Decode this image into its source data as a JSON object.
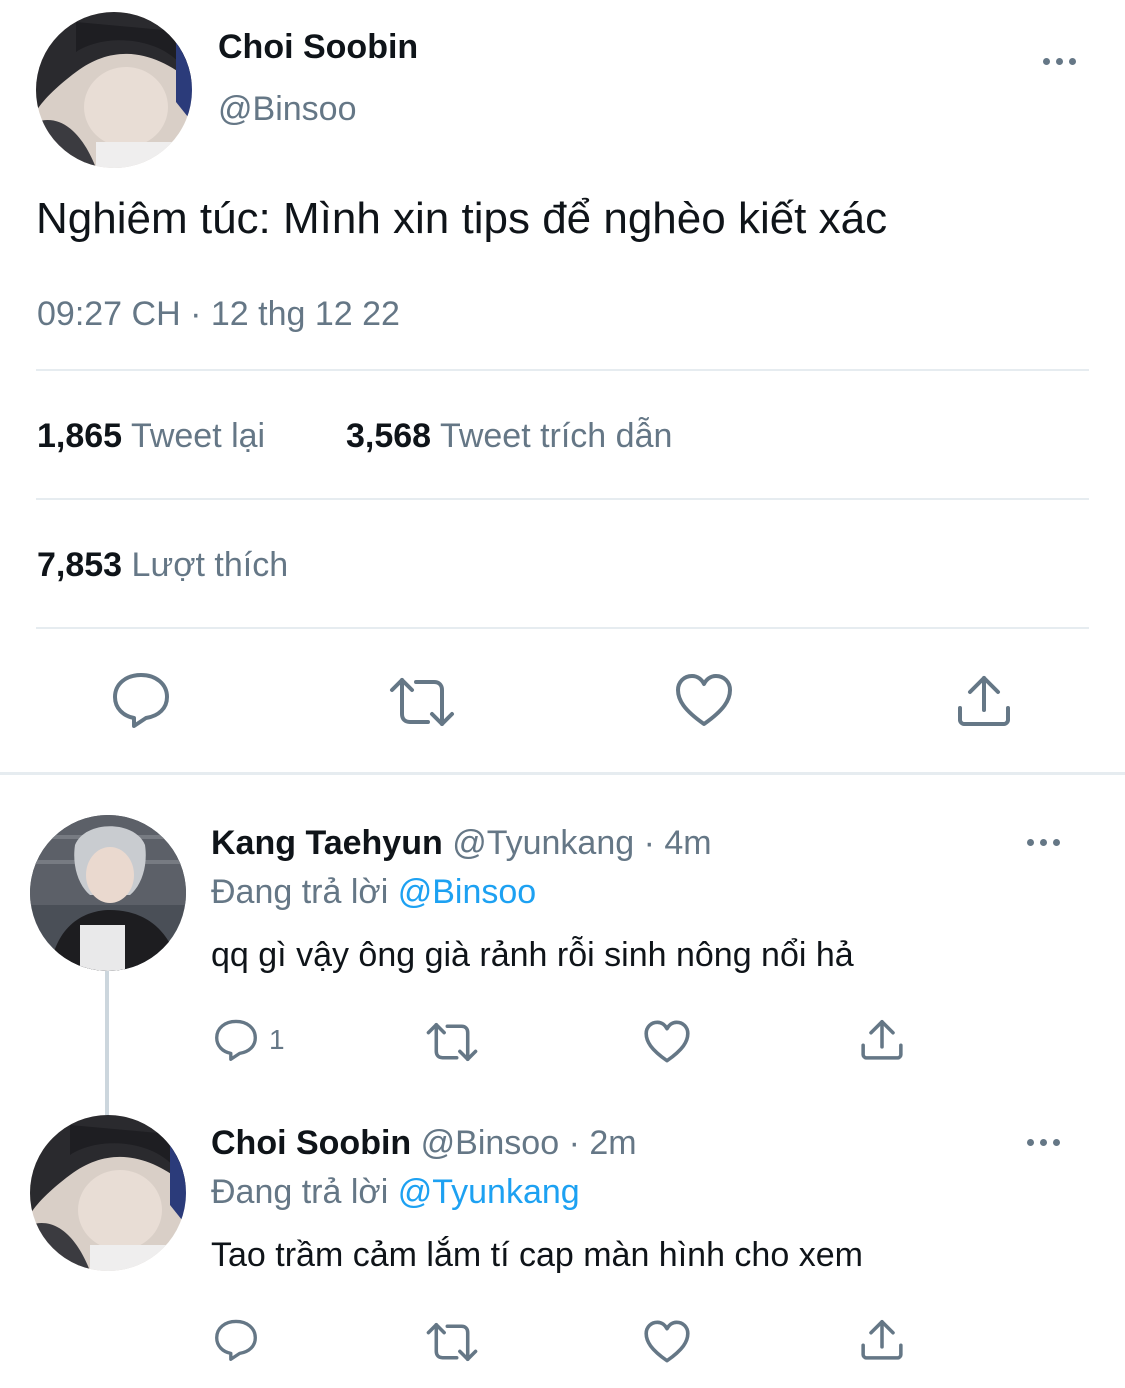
{
  "main_tweet": {
    "display_name": "Choi Soobin",
    "handle": "@Binsoo",
    "text": "Nghiêm túc: Mình xin tips để nghèo kiết xác",
    "timestamp": "09:27 CH · 12 thg 12 22",
    "retweets_count": "1,865",
    "retweets_label": "Tweet lại",
    "quotes_count": "3,568",
    "quotes_label": "Tweet trích dẫn",
    "likes_count": "7,853",
    "likes_label": "Lượt thích"
  },
  "replies": [
    {
      "display_name": "Kang Taehyun",
      "handle": "@Tyunkang",
      "time": "· 4m",
      "replying_prefix": "Đang trả lời",
      "replying_to": "@Binsoo",
      "text": "qq gì vậy ông già rảnh rỗi sinh nông nổi hả",
      "reply_count": "1"
    },
    {
      "display_name": "Choi Soobin",
      "handle": "@Binsoo",
      "time": "· 2m",
      "replying_prefix": "Đang trả lời",
      "replying_to": "@Tyunkang",
      "text": "Tao trầm cảm lắm tí cap màn hình cho xem",
      "reply_count": ""
    }
  ],
  "icons": {
    "reply": "speech-bubble-icon",
    "retweet": "retweet-arrows-icon",
    "like": "heart-icon",
    "share": "share-upload-icon",
    "more": "more-dots-icon"
  },
  "colors": {
    "text": "#0f1419",
    "secondary": "#657786",
    "link": "#1da1f2",
    "divider": "#e6ecf0"
  }
}
